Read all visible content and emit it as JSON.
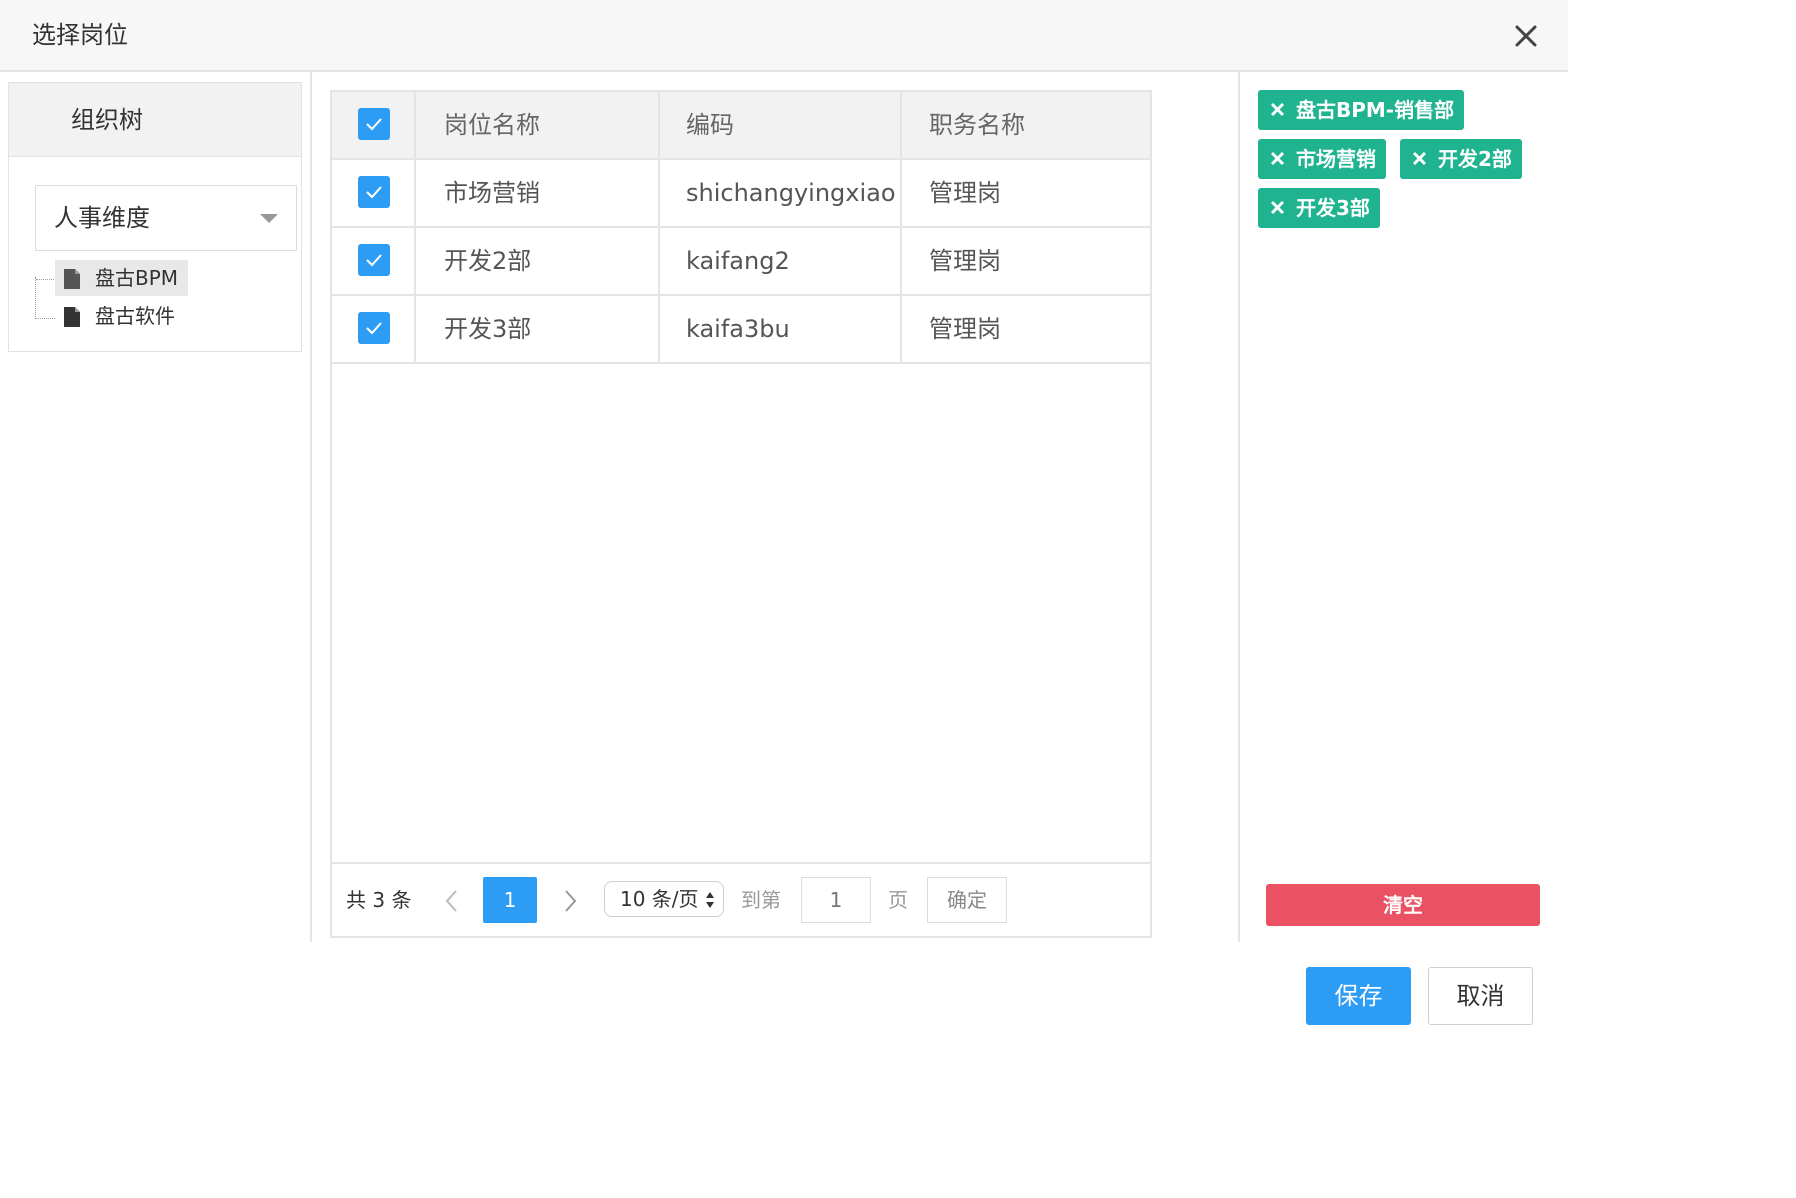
{
  "dialog": {
    "title": "选择岗位",
    "close_icon": "close-icon"
  },
  "org_tree": {
    "header": "组织树",
    "dimension_select": {
      "value": "人事维度"
    },
    "nodes": [
      {
        "label": "盘古BPM",
        "icon": "document-icon",
        "selected": true
      },
      {
        "label": "盘古软件",
        "icon": "document-icon",
        "selected": false
      }
    ]
  },
  "table": {
    "columns": [
      "岗位名称",
      "编码",
      "职务名称"
    ],
    "select_all_checked": true,
    "rows": [
      {
        "checked": true,
        "name": "市场营销",
        "code": "shichangyingxiao",
        "duty": "管理岗"
      },
      {
        "checked": true,
        "name": "开发2部",
        "code": "kaifang2",
        "duty": "管理岗"
      },
      {
        "checked": true,
        "name": "开发3部",
        "code": "kaifa3bu",
        "duty": "管理岗"
      }
    ]
  },
  "pagination": {
    "total": "共 3 条",
    "current_page": "1",
    "page_size": "10 条/页",
    "goto_label": "到第",
    "goto_value": "1",
    "page_suffix": "页",
    "confirm": "确定"
  },
  "selected": {
    "tags": [
      "盘古BPM-销售部",
      "市场营销",
      "开发2部",
      "开发3部"
    ],
    "clear_label": "清空"
  },
  "footer": {
    "save_label": "保存",
    "cancel_label": "取消"
  },
  "colors": {
    "primary": "#2d9cf5",
    "tag": "#1fb38f",
    "danger": "#ea5163"
  }
}
